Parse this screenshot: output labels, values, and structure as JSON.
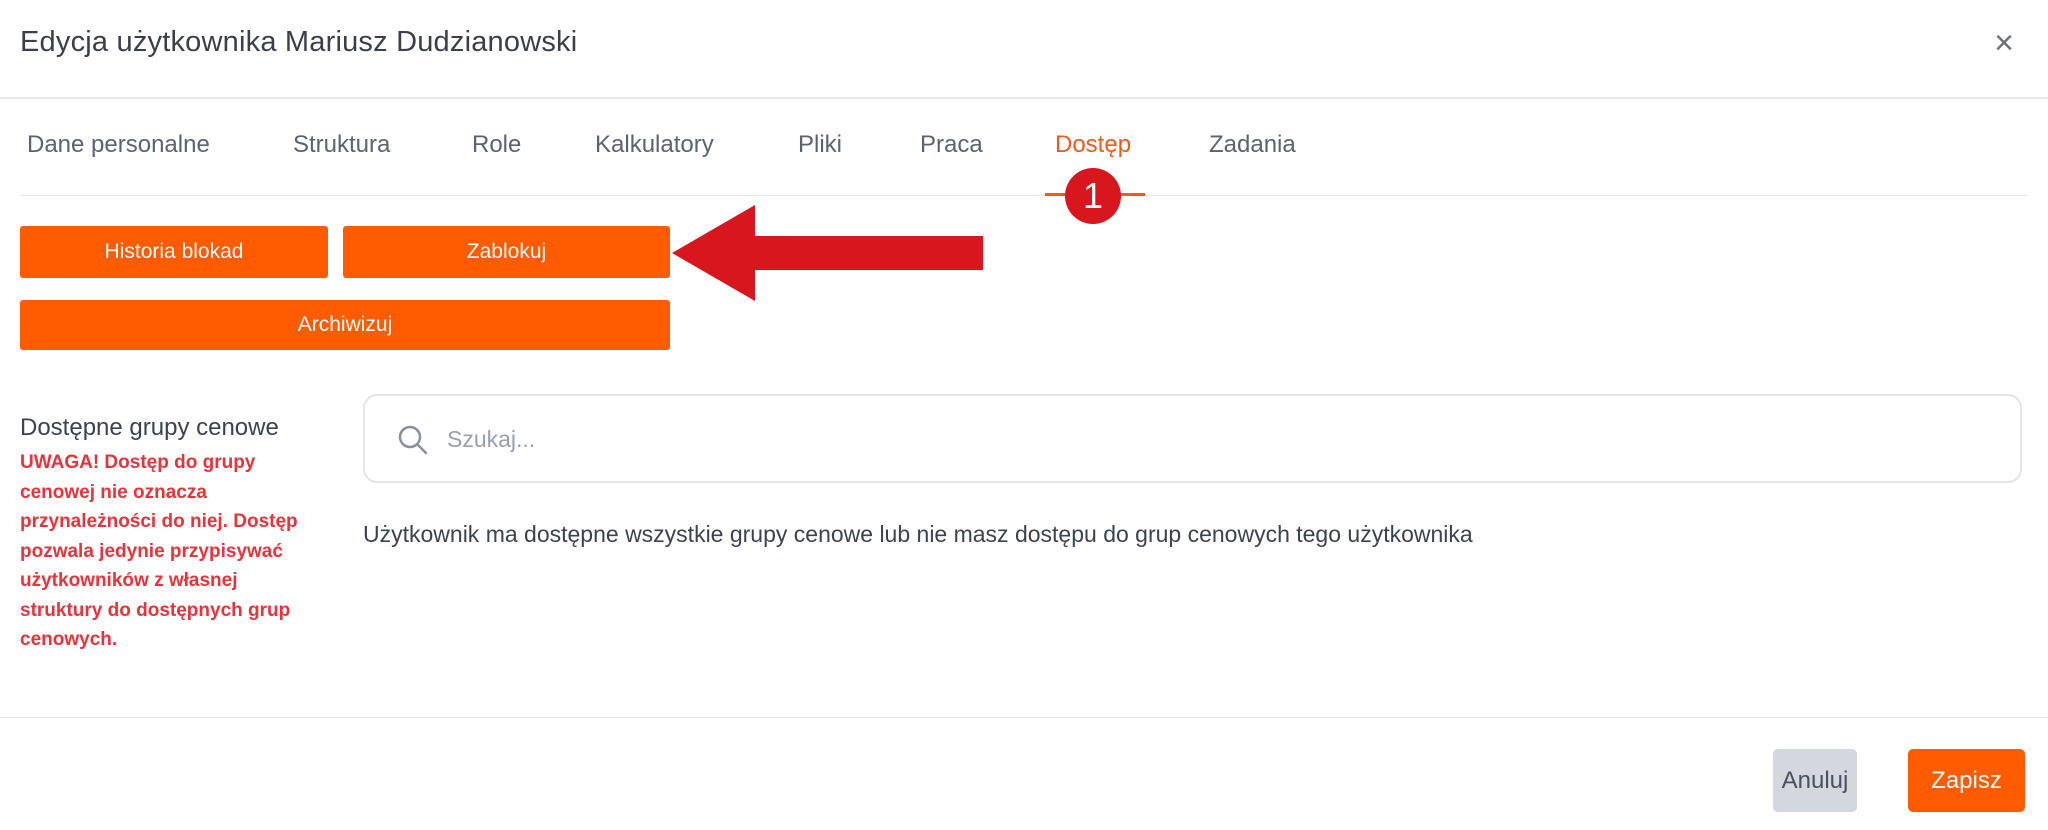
{
  "modal": {
    "title": "Edycja użytkownika Mariusz Dudzianowski",
    "close_label": "×"
  },
  "tabs": [
    {
      "label": "Dane personalne",
      "active": false
    },
    {
      "label": "Struktura",
      "active": false
    },
    {
      "label": "Role",
      "active": false
    },
    {
      "label": "Kalkulatory",
      "active": false
    },
    {
      "label": "Pliki",
      "active": false
    },
    {
      "label": "Praca",
      "active": false
    },
    {
      "label": "Dostęp",
      "active": true
    },
    {
      "label": "Zadania",
      "active": false
    }
  ],
  "annotation": {
    "badge_number": "1",
    "badge_color": "#d8161e",
    "arrow_color": "#d8161e"
  },
  "actions": {
    "history_label": "Historia blokad",
    "block_label": "Zablokuj",
    "archive_label": "Archiwizuj"
  },
  "price_groups": {
    "title": "Dostępne grupy cenowe",
    "warning": "UWAGA! Dostęp do grupy cenowej nie oznacza przynależności do niej. Dostęp pozwala jedynie przypisywać użytkowników z własnej struktury do dostępnych grup cenowych.",
    "search_placeholder": "Szukaj...",
    "info": "Użytkownik ma dostępne wszystkie grupy cenowe lub nie masz dostępu do grup cenowych tego użytkownika"
  },
  "footer": {
    "cancel_label": "Anuluj",
    "save_label": "Zapisz"
  },
  "colors": {
    "accent": "#ff5b00",
    "active_tab": "#f15a19",
    "warning": "#e8333b"
  }
}
